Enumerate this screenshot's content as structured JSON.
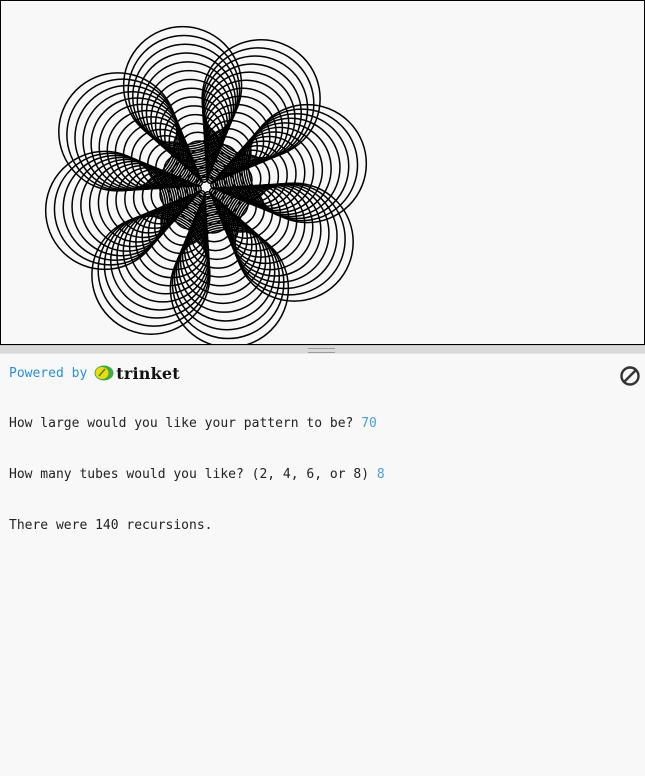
{
  "canvas": {
    "background": "#f8f8f8",
    "pen_color": "#000000",
    "pattern_size": 70,
    "tubes": 8,
    "recursions": 140
  },
  "console": {
    "powered_by_label": "Powered by",
    "brand_name": "trinket",
    "stop_icon": "stop-icon",
    "lines": [
      {
        "prompt": "How large would you like your pattern to be? ",
        "input": "70"
      },
      {
        "prompt": "How many tubes would you like? (2, 4, 6, or 8) ",
        "input": "8"
      },
      {
        "prompt": "There were 140 recursions.",
        "input": ""
      }
    ]
  },
  "colors": {
    "link_blue": "#2a8fd8",
    "input_blue": "#4a9fe0",
    "logo_yellow": "#f5d90a",
    "logo_green": "#3cab4a"
  }
}
